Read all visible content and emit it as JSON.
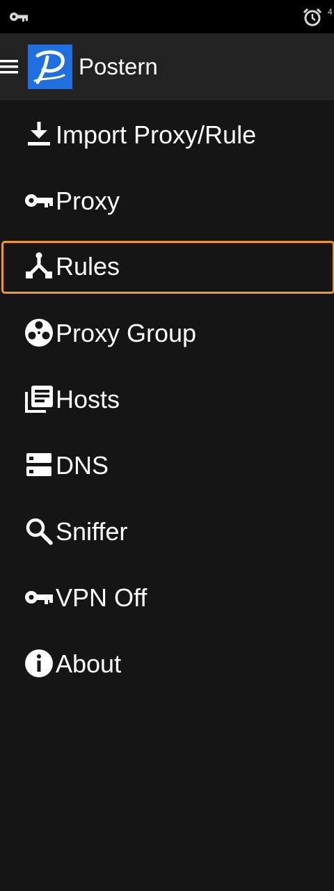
{
  "status_bar": {
    "icons": [
      "vpn-key-icon",
      "alarm-icon"
    ],
    "clipped_text": "4"
  },
  "app_bar": {
    "title": "Postern",
    "menu_icon": "hamburger-icon",
    "logo_icon": "postern-logo-icon",
    "logo_color": "#1f6fe0"
  },
  "nav": {
    "selected": "Rules",
    "focus_color": "#f29a1f",
    "items": [
      {
        "label": "Import Proxy/Rule",
        "icon": "download-icon"
      },
      {
        "label": "Proxy",
        "icon": "key-icon"
      },
      {
        "label": "Rules",
        "icon": "fork-icon"
      },
      {
        "label": "Proxy Group",
        "icon": "film-reel-icon"
      },
      {
        "label": "Hosts",
        "icon": "library-books-icon"
      },
      {
        "label": "DNS",
        "icon": "dns-icon"
      },
      {
        "label": "Sniffer",
        "icon": "search-icon"
      },
      {
        "label": "VPN Off",
        "icon": "key-icon"
      },
      {
        "label": "About",
        "icon": "info-icon"
      }
    ]
  }
}
